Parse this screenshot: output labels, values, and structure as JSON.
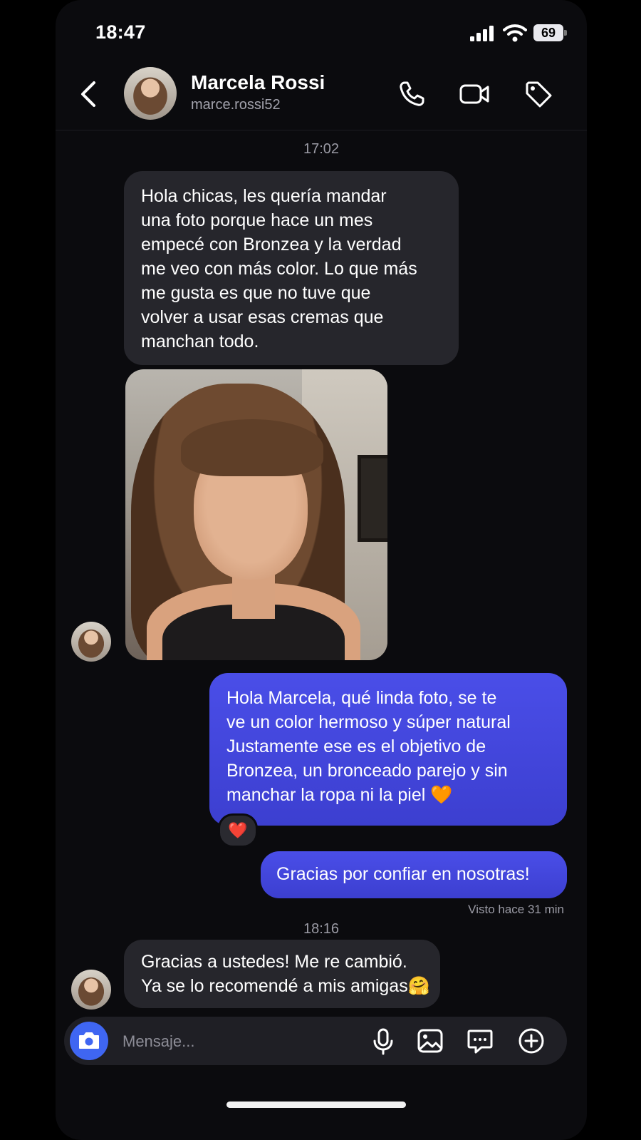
{
  "status_bar": {
    "time": "18:47",
    "battery": "69"
  },
  "header": {
    "name": "Marcela Rossi",
    "handle": "marce.rossi52"
  },
  "icons": {
    "back": "chevron-left-icon",
    "call": "phone-icon",
    "video": "video-camera-icon",
    "tag": "tag-icon",
    "camera": "camera-icon",
    "mic": "microphone-icon",
    "gallery": "image-icon",
    "sticker": "chat-bubble-icon",
    "plus": "plus-circle-icon"
  },
  "conversation": {
    "timestamp_1": "17:02",
    "message_1": {
      "lines": [
        "Hola chicas, les quería mandar",
        "una foto porque hace un mes",
        "empecé con Bronzea y la verdad",
        "me veo con más color. Lo que más",
        "me gusta es que no tuve que",
        "volver a usar esas cremas que",
        "manchan todo."
      ]
    },
    "message_2": {
      "lines": [
        "Hola Marcela, qué linda foto, se te",
        "ve un color hermoso y súper natural",
        "Justamente ese es el objetivo de",
        "Bronzea, un bronceado parejo y sin",
        "manchar la ropa ni la piel 🧡"
      ],
      "reaction": "❤️"
    },
    "message_3": "Gracias por confiar en nosotras!",
    "seen": "Visto hace 31 min",
    "timestamp_2": "18:16",
    "message_4": {
      "lines": [
        "Gracias a ustedes! Me re cambió.",
        "Ya se lo recomendé a mis amigas🤗"
      ]
    }
  },
  "composer": {
    "placeholder": "Mensaje..."
  },
  "colors": {
    "outgoing_bubble": "#4548e0",
    "incoming_bubble": "#26262c",
    "camera_button": "#3f66f2"
  }
}
